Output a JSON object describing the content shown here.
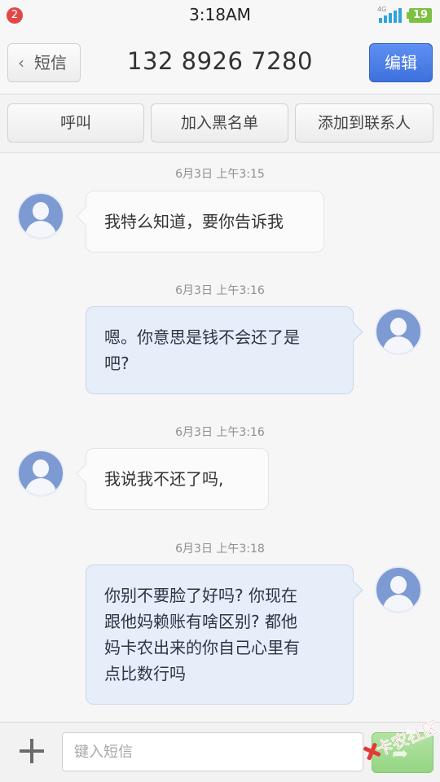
{
  "status_bar": {
    "notification_count": "2",
    "time": "3:18AM",
    "network": "4G",
    "battery": "19",
    "icons": [
      "notification-badge",
      "signal-icon",
      "battery-icon"
    ],
    "battery_color": "#7cc142"
  },
  "header": {
    "back_label": "短信",
    "back_icon": "chevron-left-icon",
    "title": "132 8926 7280",
    "edit_label": "编辑",
    "accent_color": "#4a7be6"
  },
  "actions": {
    "call_label": "呼叫",
    "blacklist_label": "加入黑名单",
    "add_contact_label": "添加到联系人"
  },
  "messages": [
    {
      "timestamp": "6月3日 上午3:15",
      "direction": "incoming",
      "text": "我特么知道，要你告诉我"
    },
    {
      "timestamp": "6月3日 上午3:16",
      "direction": "outgoing",
      "lines": [
        "嗯。你意思是钱不会还了是",
        "吧?"
      ]
    },
    {
      "timestamp": "6月3日 上午3:16",
      "direction": "incoming",
      "text": "我说我不还了吗,"
    },
    {
      "timestamp": "6月3日 上午3:18",
      "direction": "outgoing",
      "lines": [
        "你别不要脸了好吗? 你现在",
        "跟他妈赖账有啥区别? 都他",
        "妈卡农出来的你自己心里有",
        "点比数行吗"
      ]
    }
  ],
  "composer": {
    "add_icon": "plus-icon",
    "placeholder": "键入短信",
    "send_icon": "send-arrow-icon",
    "send_color": "#9ed98d"
  },
  "watermark": {
    "text": "卡农社区",
    "logo": "x-logo"
  }
}
